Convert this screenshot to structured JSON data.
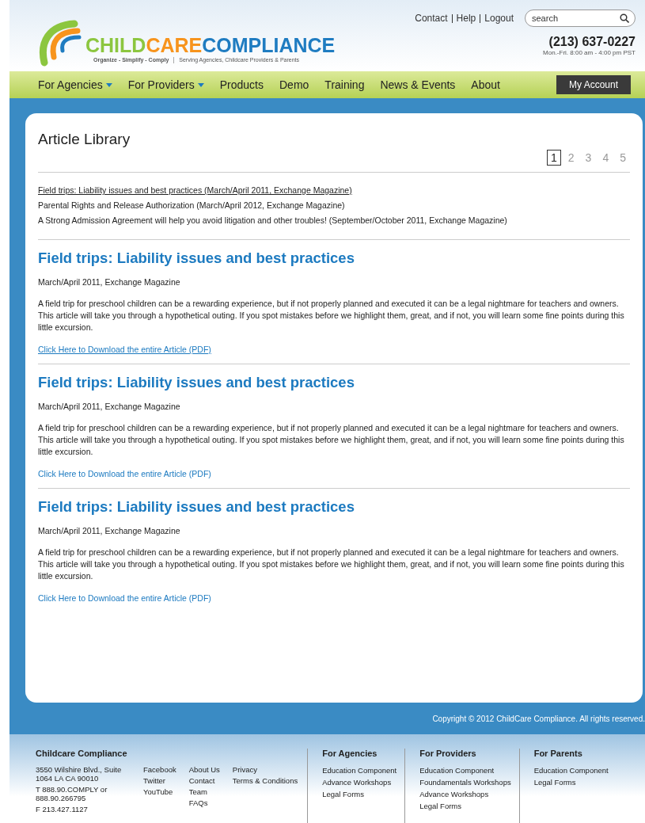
{
  "header": {
    "top_links": [
      "Contact",
      "Help",
      "Logout"
    ],
    "search": {
      "placeholder": "search"
    },
    "logo": {
      "words": [
        {
          "text": "CHILD",
          "color": "#8cc63f"
        },
        {
          "text": "CARE",
          "color": "#f7941d"
        },
        {
          "text": "COMPLIANCE",
          "color": "#1f7cc1"
        }
      ],
      "tagline": "Organize - Simplify - Comply",
      "subtitle": "Serving Agencies, Childcare Providers & Parents"
    },
    "phone": "(213) 637-0227",
    "hours": "Mon.-Fri. 8:00 am - 4:00 pm PST"
  },
  "nav": {
    "items": [
      {
        "label": "For Agencies",
        "has_dropdown": true
      },
      {
        "label": "For Providers",
        "has_dropdown": true
      },
      {
        "label": "Products",
        "has_dropdown": false
      },
      {
        "label": "Demo",
        "has_dropdown": false
      },
      {
        "label": "Training",
        "has_dropdown": false
      },
      {
        "label": "News & Events",
        "has_dropdown": false
      },
      {
        "label": "About",
        "has_dropdown": false
      }
    ],
    "account_button": "My Account"
  },
  "library": {
    "title": "Article Library",
    "pages": [
      {
        "label": "1",
        "selected": true
      },
      {
        "label": "2",
        "selected": false
      },
      {
        "label": "3",
        "selected": false
      },
      {
        "label": "4",
        "selected": false
      },
      {
        "label": "5",
        "selected": false
      }
    ],
    "index": [
      {
        "text": "Field trips: Liability issues and best practices (March/April 2011, Exchange Magazine)",
        "hovered": true
      },
      {
        "text": "Parental Rights and Release Authorization (March/April 2012, Exchange Magazine)",
        "hovered": false
      },
      {
        "text": "A Strong Admission Agreement will help you avoid litigation and other troubles! (September/October 2011, Exchange Magazine)",
        "hovered": false
      }
    ],
    "articles": [
      {
        "title": "Field trips: Liability issues and best practices",
        "meta": "March/April 2011, Exchange Magazine",
        "body": "A field trip for preschool children can be a rewarding experience, but if not properly planned and executed it can be a legal nightmare for teachers and owners. This article will take you through a hypothetical outing. If you spot mistakes before we highlight them, great, and if not, you will learn some fine points during this little excursion.",
        "link": "Click Here to Download the entire Article (PDF)",
        "link_hovered": true
      },
      {
        "title": "Field trips: Liability issues and best practices",
        "meta": "March/April 2011, Exchange Magazine",
        "body": "A field trip for preschool children can be a rewarding experience, but if not properly planned and executed it can be a legal nightmare for teachers and owners. This article will take you through a hypothetical outing. If you spot mistakes before we highlight them, great, and if not, you will learn some fine points during this little excursion.",
        "link": "Click Here to Download the entire Article (PDF)",
        "link_hovered": false
      },
      {
        "title": "Field trips: Liability issues and best practices",
        "meta": "March/April 2011, Exchange Magazine",
        "body": "A field trip for preschool children can be a rewarding experience, but if not properly planned and executed it can be a legal nightmare for teachers and owners. This article will take you through a hypothetical outing. If you spot mistakes before we highlight them, great, and if not, you will learn some fine points during this little excursion.",
        "link": "Click Here to Download the entire Article (PDF)",
        "link_hovered": false
      }
    ]
  },
  "footer": {
    "copyright": "Copyright © 2012 ChildCare Compliance. All rights reserved.",
    "company": {
      "title": "Childcare Compliance",
      "address": [
        "3550 Wilshire Blvd., Suite 1064 LA CA 90010",
        "T 888.90.COMPLY or 888.90.266795",
        "F 213.427.1127"
      ]
    },
    "social": [
      "Facebook",
      "Twitter",
      "YouTube"
    ],
    "links": [
      "About Us",
      "Contact",
      "Team",
      "FAQs"
    ],
    "legal": [
      "Privacy",
      "Terms & Conditions"
    ],
    "columns": [
      {
        "title": "For Agencies",
        "items": [
          "Education Component",
          "Advance Workshops",
          "Legal Forms"
        ]
      },
      {
        "title": "For Providers",
        "items": [
          "Education Component",
          "Foundamentals Workshops",
          "Advance Workshops",
          "Legal Forms"
        ]
      },
      {
        "title": "For Parents",
        "items": [
          "Education Component",
          "Legal Forms"
        ]
      }
    ]
  }
}
